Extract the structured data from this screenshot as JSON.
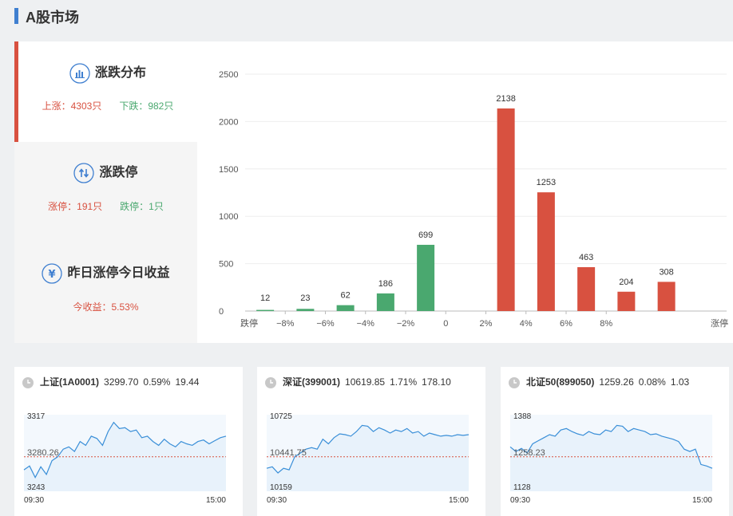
{
  "header": {
    "title": "A股市场"
  },
  "side": {
    "dist": {
      "title": "涨跌分布",
      "up": "上涨：4303只",
      "down": "下跌：982只",
      "icon": "bar-chart-icon"
    },
    "limit": {
      "title": "涨跌停",
      "up": "涨停：191只",
      "down": "跌停：1只",
      "icon": "up-down-arrows-icon"
    },
    "yield": {
      "title": "昨日涨停今日收益",
      "value": "今收益：5.53%",
      "icon": "yuan-icon"
    }
  },
  "colors": {
    "up": "#d85140",
    "down": "#4aa86f",
    "accent": "#3f7fd0",
    "line": "#3a8fd8"
  },
  "chart_data": {
    "type": "bar",
    "categories": [
      "跌停",
      "-8%~跌停",
      "-6%~-8%",
      "-4%~-6%",
      "-2%~-4%",
      "0~-2%",
      "0~2%",
      "2%~4%",
      "4%~6%",
      "6%~8%",
      "8%~涨停",
      "涨停"
    ],
    "values": [
      12,
      23,
      62,
      186,
      699,
      0,
      2138,
      1253,
      463,
      204,
      308,
      0
    ],
    "value_labels": [
      "12",
      "23",
      "62",
      "186",
      "699",
      "",
      "2138",
      "1253",
      "463",
      "204",
      "308",
      ""
    ],
    "bar_colors": [
      "down",
      "down",
      "down",
      "down",
      "down",
      "none",
      "up",
      "up",
      "up",
      "up",
      "up",
      "none"
    ],
    "yticks": [
      "0",
      "500",
      "1000",
      "1500",
      "2000",
      "2500"
    ],
    "ylim": [
      0,
      2500
    ],
    "xtick_labels": [
      "跌停",
      "−8%",
      "−6%",
      "−4%",
      "−2%",
      "0",
      "2%",
      "4%",
      "6%",
      "8%",
      "涨停"
    ],
    "grid": true
  },
  "indices": [
    {
      "name": "上证(1A0001)",
      "price": "3299.70",
      "pct": "0.59%",
      "chg": "19.44",
      "top": "3317",
      "bottom": "3243",
      "ref": "3280.26",
      "t0": "09:30",
      "t1": "15:00"
    },
    {
      "name": "深证(399001)",
      "price": "10619.85",
      "pct": "1.71%",
      "chg": "178.10",
      "top": "10725",
      "bottom": "10159",
      "ref": "10441.75",
      "t0": "09:30",
      "t1": "15:00"
    },
    {
      "name": "北证50(899050)",
      "price": "1259.26",
      "pct": "0.08%",
      "chg": "1.03",
      "top": "1388",
      "bottom": "1128",
      "ref": "1258.23",
      "t0": "09:30",
      "t1": "15:00"
    }
  ]
}
